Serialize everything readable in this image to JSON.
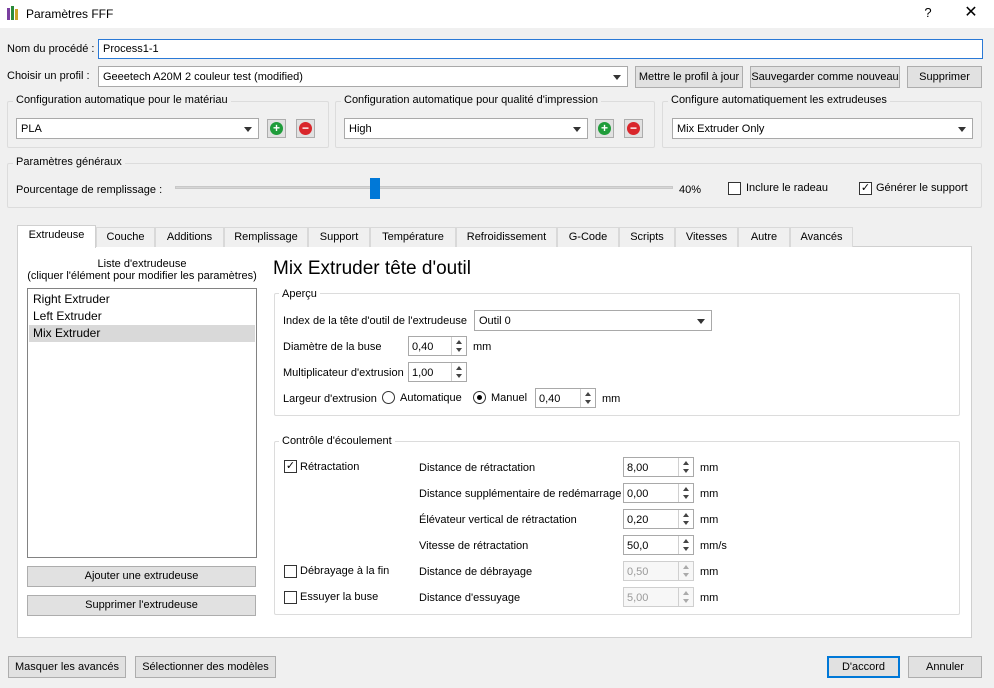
{
  "window": {
    "title": "Paramètres FFF",
    "help": "?",
    "close": "✕",
    "icon": "app-icon"
  },
  "process_name": {
    "label": "Nom du procédé :",
    "value": "Process1-1"
  },
  "profile": {
    "label": "Choisir un profil :",
    "selected": "Geeetech A20M 2 couleur test (modified)",
    "update_btn": "Mettre le profil à jour",
    "save_new_btn": "Sauvegarder comme nouveau",
    "delete_btn": "Supprimer"
  },
  "auto_config": {
    "material": {
      "title": "Configuration automatique pour le matériau",
      "selected": "PLA"
    },
    "quality": {
      "title": "Configuration automatique pour qualité d'impression",
      "selected": "High"
    },
    "extruders": {
      "title": "Configure automatiquement les extrudeuses",
      "selected": "Mix Extruder Only"
    }
  },
  "general": {
    "title": "Paramètres généraux",
    "infill_label": "Pourcentage de remplissage :",
    "infill_value_text": "40%",
    "infill_value": 40,
    "raft_label": "Inclure le radeau",
    "raft_checked": false,
    "support_label": "Générer le support",
    "support_checked": true
  },
  "tabs": [
    "Extrudeuse",
    "Couche",
    "Additions",
    "Remplissage",
    "Support",
    "Température",
    "Refroidissement",
    "G-Code",
    "Scripts",
    "Vitesses",
    "Autre",
    "Avancés"
  ],
  "active_tab": "Extrudeuse",
  "extruder_list": {
    "caption_line1": "Liste d'extrudeuse",
    "caption_line2": "(cliquer l'élément pour modifier les paramètres)",
    "items": [
      "Right Extruder",
      "Left Extruder",
      "Mix Extruder"
    ],
    "selected": "Mix Extruder",
    "add_btn": "Ajouter une extrudeuse",
    "remove_btn": "Supprimer l'extrudeuse"
  },
  "detail": {
    "heading": "Mix Extruder tête d'outil",
    "overview": {
      "title": "Aperçu",
      "tool_index_label": "Index de la tête d'outil de l'extrudeuse",
      "tool_index_value": "Outil 0",
      "nozzle_label": "Diamètre de la buse",
      "nozzle_value": "0,40",
      "nozzle_unit": "mm",
      "multiplier_label": "Multiplicateur d'extrusion",
      "multiplier_value": "1,00",
      "width_label": "Largeur d'extrusion",
      "width_auto": "Automatique",
      "width_manual": "Manuel",
      "width_value": "0,40",
      "width_unit": "mm"
    },
    "flow": {
      "title": "Contrôle d'écoulement",
      "retraction_label": "Rétractation",
      "retraction_checked": true,
      "coast_label": "Débrayage à la fin",
      "coast_checked": false,
      "wipe_label": "Essuyer la buse",
      "wipe_checked": false,
      "rows": [
        {
          "label": "Distance de rétractation",
          "value": "8,00",
          "unit": "mm",
          "enabled": true
        },
        {
          "label": "Distance supplémentaire de redémarrage",
          "value": "0,00",
          "unit": "mm",
          "enabled": true
        },
        {
          "label": "Élévateur vertical de rétractation",
          "value": "0,20",
          "unit": "mm",
          "enabled": true
        },
        {
          "label": "Vitesse de rétractation",
          "value": "50,0",
          "unit": "mm/s",
          "enabled": true
        },
        {
          "label": "Distance de débrayage",
          "value": "0,50",
          "unit": "mm",
          "enabled": false
        },
        {
          "label": "Distance d'essuyage",
          "value": "5,00",
          "unit": "mm",
          "enabled": false
        }
      ]
    }
  },
  "footer": {
    "hide_advanced": "Masquer les avancés",
    "select_models": "Sélectionner des modèles",
    "ok": "D'accord",
    "cancel": "Annuler"
  },
  "colors": {
    "accent": "#0078d7",
    "add_green": "#1f9c3a",
    "remove_red": "#d9262b",
    "selection": "#d9d9d9"
  }
}
